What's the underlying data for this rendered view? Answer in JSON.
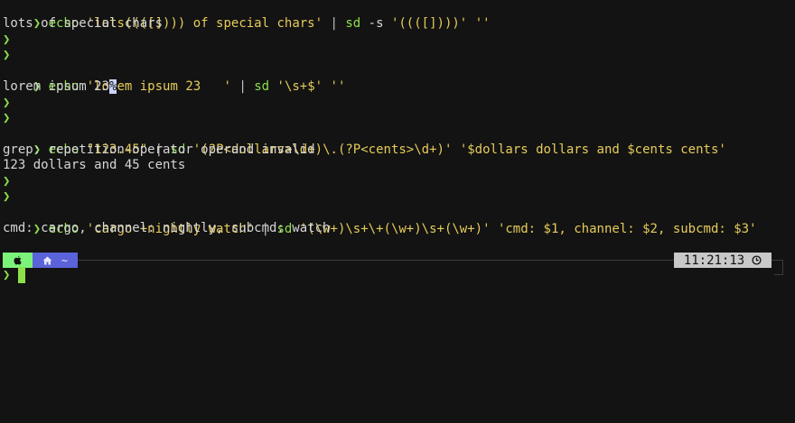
{
  "terminal": {
    "prompt_symbol": "❯",
    "lines": [
      {
        "echo": "echo",
        "arg": "'lots((([]))) of special chars'",
        "pipe": "|",
        "sd": "sd",
        "flags": "-s",
        "pattern": "'((([])))'",
        "replacement": "''"
      },
      {
        "output": "lots of special chars"
      },
      {
        "echo": "echo",
        "arg": "'lorem ipsum 23   '",
        "pipe": "|",
        "sd": "sd",
        "pattern": "'\\s+$'",
        "replacement": "''"
      },
      {
        "output": "lorem ipsum 23",
        "cursor": "%"
      },
      {
        "echo": "echo",
        "arg": "\"123.45\"",
        "pipe": "|",
        "sd": "sd",
        "pattern": "'(?P<dollars>\\d+)\\.(?P<cents>\\d+)'",
        "replacement": "'$dollars dollars and $cents cents'"
      },
      {
        "output": "grep: repetition-operator operand invalid"
      },
      {
        "output": "123 dollars and 45 cents"
      },
      {
        "echo": "echo",
        "arg": "'cargo +nightly watch'",
        "pipe": "|",
        "sd": "sd",
        "pattern": "'(\\w+)\\s+\\+(\\w+)\\s+(\\w+)'",
        "replacement": "'cmd: $1, channel: $2, subcmd: $3'"
      },
      {
        "output": "cmd: cargo, channel: nightly, subcmd: watch"
      }
    ]
  },
  "status_bar": {
    "apple_icon": "apple-icon",
    "home_icon": "home-icon",
    "path": "~",
    "time": "11:21:13",
    "clock_icon": "clock-icon",
    "colors": {
      "apple_segment": "#7bf37a",
      "path_segment": "#5a63d9",
      "time_segment": "#c8c8c8"
    }
  }
}
